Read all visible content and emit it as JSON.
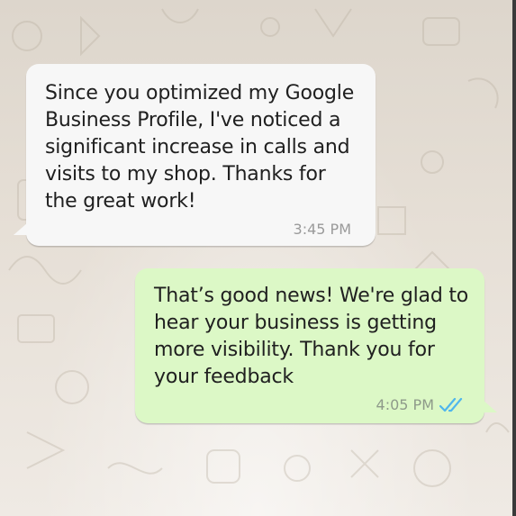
{
  "messages": [
    {
      "direction": "incoming",
      "text": "Since you optimized my Google Business Profile, I've noticed a significant increase in calls and visits to my shop. Thanks for the great work!",
      "time": "3:45 PM"
    },
    {
      "direction": "outgoing",
      "text": "That’s good news! We're glad to hear your business is getting more visibility. Thank you for your feedback",
      "time": "4:05 PM",
      "status_icon": "double-check-read-icon"
    }
  ],
  "colors": {
    "incoming_bubble": "#f7f7f7",
    "outgoing_bubble": "#dcf8c6",
    "read_ticks": "#4fb6ec",
    "timestamp": "#9a9a9a"
  }
}
